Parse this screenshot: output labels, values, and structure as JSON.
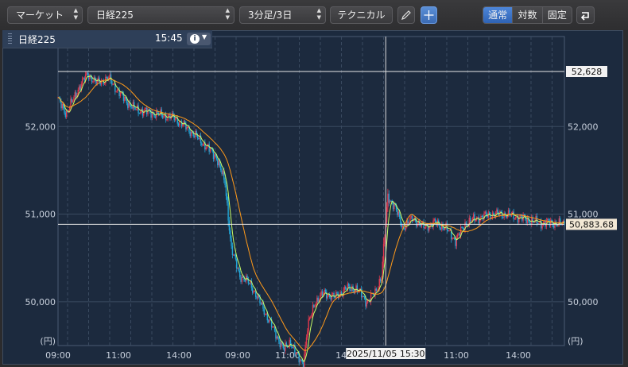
{
  "toolbar": {
    "market_select": "マーケット",
    "symbol_select": "日経225",
    "period_select": "3分足/3日",
    "technical_button": "テクニカル",
    "scale_modes": [
      "通常",
      "対数",
      "固定"
    ],
    "active_scale": "通常"
  },
  "panel": {
    "title": "日経225",
    "time": "15:45"
  },
  "chart_data": {
    "type": "candlestick",
    "ylim": [
      49500,
      52900
    ],
    "yticks": [
      "52,000",
      "51,000",
      "50,000"
    ],
    "yticks_values": [
      52000,
      51000,
      50000
    ],
    "y_unit": "(円)",
    "xticks": [
      "09:00",
      "11:00",
      "14:00",
      "09:00",
      "11:00",
      "14:00",
      "11:00",
      "14:00"
    ],
    "hline_label": "52,628",
    "hline_value": 52628,
    "current_label": "50,883.68",
    "current_value": 50883.68,
    "crosshair_label": "2025/11/05 15:30",
    "key_points": [
      [
        0,
        52300
      ],
      [
        8,
        52150
      ],
      [
        20,
        52450
      ],
      [
        28,
        52600
      ],
      [
        36,
        52500
      ],
      [
        48,
        52550
      ],
      [
        60,
        52350
      ],
      [
        72,
        52200
      ],
      [
        90,
        52150
      ],
      [
        110,
        52100
      ],
      [
        125,
        51950
      ],
      [
        138,
        51800
      ],
      [
        150,
        51650
      ],
      [
        158,
        51350
      ],
      [
        164,
        50600
      ],
      [
        172,
        50300
      ],
      [
        182,
        50200
      ],
      [
        195,
        49900
      ],
      [
        205,
        49650
      ],
      [
        214,
        49450
      ],
      [
        220,
        49550
      ],
      [
        227,
        49350
      ],
      [
        232,
        49300
      ],
      [
        236,
        49700
      ],
      [
        243,
        50000
      ],
      [
        252,
        50100
      ],
      [
        262,
        50050
      ],
      [
        272,
        50150
      ],
      [
        282,
        50150
      ],
      [
        292,
        50000
      ],
      [
        300,
        50100
      ],
      [
        306,
        50300
      ],
      [
        312,
        51200
      ],
      [
        318,
        51100
      ],
      [
        326,
        50850
      ],
      [
        336,
        50950
      ],
      [
        346,
        50850
      ],
      [
        356,
        50900
      ],
      [
        366,
        50850
      ],
      [
        376,
        50700
      ],
      [
        386,
        50900
      ],
      [
        396,
        50950
      ],
      [
        410,
        51000
      ],
      [
        424,
        51000
      ],
      [
        440,
        50950
      ],
      [
        455,
        50900
      ],
      [
        468,
        50900
      ],
      [
        478,
        50883.68
      ]
    ],
    "crosshair_index": 310,
    "ma_short_color": "#c8ff66",
    "ma_long_color": "#ff9a1a",
    "up_color": "#e2384e",
    "down_color": "#22a6d8"
  },
  "colors": {
    "panel_bg": "#1c2a3e",
    "grid": "#3a4a60",
    "active_tab": "#3f78cf"
  }
}
